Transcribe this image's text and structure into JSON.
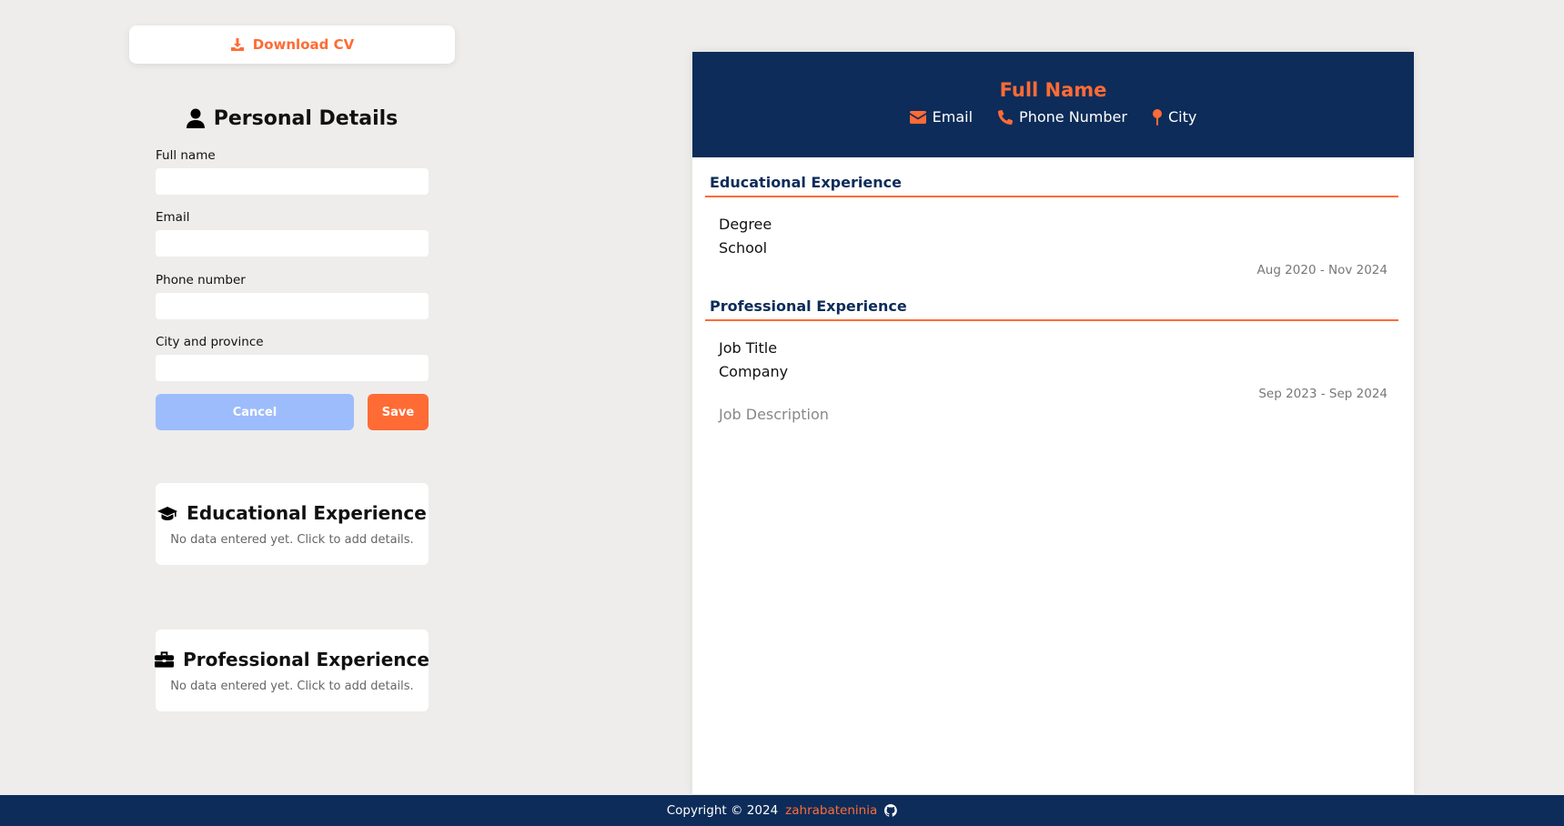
{
  "left": {
    "download_label": "Download CV",
    "personal_title": "Personal Details",
    "fields": [
      {
        "label": "Full name",
        "value": ""
      },
      {
        "label": "Email",
        "value": ""
      },
      {
        "label": "Phone number",
        "value": ""
      },
      {
        "label": "City and province",
        "value": ""
      }
    ],
    "cancel_label": "Cancel",
    "save_label": "Save",
    "edu_card": {
      "title": "Educational Experience",
      "subtitle": "No data entered yet. Click to add details."
    },
    "pro_card": {
      "title": "Professional Experience",
      "subtitle": "No data entered yet. Click to add details."
    }
  },
  "cv": {
    "name": "Full Name",
    "email": "Email",
    "phone": "Phone Number",
    "city": "City",
    "education": {
      "title": "Educational Experience",
      "degree": "Degree",
      "school": "School",
      "dates": "Aug 2020 - Nov 2024"
    },
    "professional": {
      "title": "Professional Experience",
      "job_title": "Job Title",
      "company": "Company",
      "dates": "Sep 2023 - Sep 2024",
      "description": "Job Description"
    }
  },
  "footer": {
    "copyright": "Copyright © 2024",
    "author": "zahrabateninia"
  },
  "colors": {
    "accent": "#ff6b35",
    "navy": "#0d2c59",
    "cancel": "#9dbcfb",
    "background": "#eeedeb"
  }
}
